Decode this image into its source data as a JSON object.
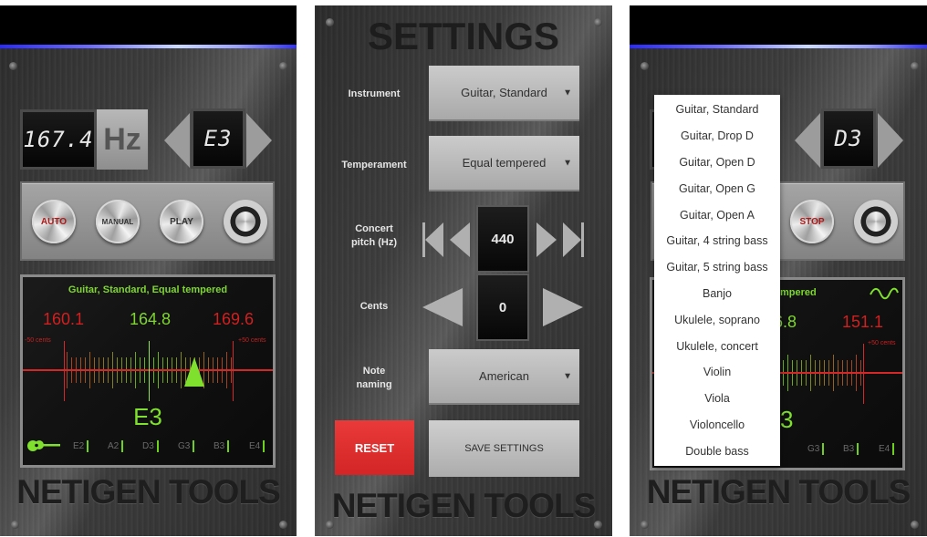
{
  "panels": {
    "tuner": {
      "frequency_display": "167.4",
      "unit_label": "Hz",
      "note_display": "E3",
      "buttons": {
        "auto": "AUTO",
        "manual": "MANUAL",
        "play": "PLAY",
        "settings_icon": "gear-icon"
      },
      "screen": {
        "subtitle": "Guitar, Standard, Equal tempered",
        "freq_low": "160.1",
        "freq_target": "164.8",
        "freq_high": "169.6",
        "cents_low_label": "-50 cents",
        "cents_high_label": "+50 cents",
        "needle_offset_cents": 27,
        "detected_note": "E3",
        "strings": [
          "E2",
          "A2",
          "D3",
          "G3",
          "B3",
          "E4"
        ],
        "instrument_icon": "guitar-icon"
      },
      "brand": "NETIGEN TOOLS"
    },
    "settings": {
      "title": "SETTINGS",
      "instrument_label": "Instrument",
      "instrument_value": "Guitar, Standard",
      "temperament_label": "Temperament",
      "temperament_value": "Equal tempered",
      "concert_pitch_label_line1": "Concert",
      "concert_pitch_label_line2": "pitch (Hz)",
      "concert_pitch_value": "440",
      "cents_label": "Cents",
      "cents_value": "0",
      "note_naming_label_line1": "Note",
      "note_naming_label_line2": "naming",
      "note_naming_value": "American",
      "reset_label": "RESET",
      "save_label": "SAVE SETTINGS",
      "brand": "NETIGEN TOOLS",
      "reset_color": "#e03030"
    },
    "instrument_menu": {
      "note_display": "D3",
      "stop_label": "STOP",
      "screen": {
        "subtitle_visible": "mpered",
        "freq_target_visible": "6.8",
        "freq_high": "151.1",
        "cents_high_label": "+50 cents",
        "detected_note_visible": "3",
        "strings_visible": [
          "G3",
          "B3",
          "E4"
        ],
        "signal_icon": "sine-wave-icon"
      },
      "items": [
        "Guitar, Standard",
        "Guitar, Drop D",
        "Guitar, Open D",
        "Guitar, Open G",
        "Guitar, Open A",
        "Guitar, 4 string bass",
        "Guitar, 5 string bass",
        "Banjo",
        "Ukulele, soprano",
        "Ukulele, concert",
        "Violin",
        "Viola",
        "Violoncello",
        "Double bass"
      ],
      "brand": "NETIGEN TOOLS"
    }
  },
  "colors": {
    "lcd_green": "#7fd630",
    "lcd_red": "#d21f1f",
    "status_glow": "#6b6bff"
  }
}
